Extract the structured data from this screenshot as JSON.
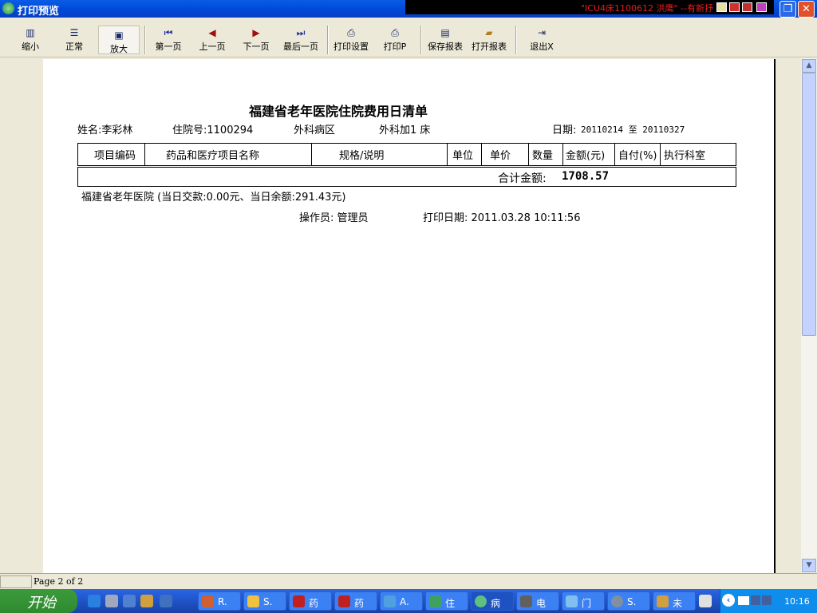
{
  "window": {
    "title": "打印预览",
    "ticker": "\"ICU4床1100612 洪鹰\" --有新抒"
  },
  "toolbar": [
    {
      "label": "缩小",
      "icon": "zoom-out-icon"
    },
    {
      "label": "正常",
      "icon": "normal-view-icon"
    },
    {
      "label": "放大",
      "icon": "zoom-in-icon",
      "active": true
    },
    {
      "label": "第一页",
      "icon": "first-page-icon"
    },
    {
      "label": "上一页",
      "icon": "prev-page-icon"
    },
    {
      "label": "下一页",
      "icon": "next-page-icon"
    },
    {
      "label": "最后一页",
      "icon": "last-page-icon"
    },
    {
      "label": "打印设置",
      "icon": "print-setup-icon"
    },
    {
      "label": "打印P",
      "icon": "printer-icon"
    },
    {
      "label": "保存报表",
      "icon": "save-icon"
    },
    {
      "label": "打开报表",
      "icon": "open-folder-icon"
    },
    {
      "label": "退出X",
      "icon": "exit-icon"
    }
  ],
  "report": {
    "title": "福建省老年医院住院费用日清单",
    "name": "姓名:李彩林",
    "admission_no": "住院号:1100294",
    "ward": "外科病区",
    "bed": "外科加1 床",
    "date_label": "日期:",
    "date_range": "20110214 至 20110327",
    "columns": [
      "项目编码",
      "药品和医疗项目名称",
      "规格/说明",
      "单位",
      "单价",
      "数量",
      "金额(元)",
      "自付(%)",
      "执行科室"
    ],
    "total_label": "合计金额:",
    "total_value": "1708.57",
    "summary": "福建省老年医院 (当日交款:0.00元、当日余额:291.43元)",
    "operator": "操作员: 管理员",
    "print_date": "打印日期: 2011.03.28 10:11:56"
  },
  "status": {
    "page": "Page 2 of 2"
  },
  "taskbar": {
    "start": "开始",
    "tasks": [
      "R.",
      "S.",
      "药",
      "药",
      "A.",
      "住",
      "病",
      "电",
      "门",
      "S.",
      "未"
    ],
    "active_task": "病",
    "clock": "10:16"
  }
}
